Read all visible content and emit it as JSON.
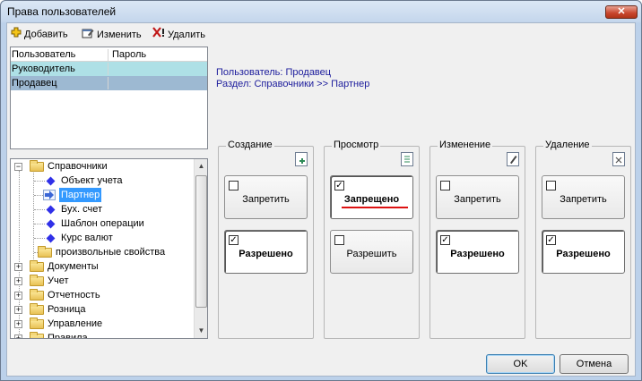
{
  "window": {
    "title": "Права пользователей",
    "close_label": "✕"
  },
  "toolbar": {
    "add_label": "Добавить",
    "edit_label": "Изменить",
    "delete_label": "Удалить"
  },
  "users_table": {
    "columns": [
      "Пользователь",
      "Пароль"
    ],
    "rows": [
      {
        "user": "Руководитель",
        "password": ""
      },
      {
        "user": "Продавец",
        "password": ""
      }
    ]
  },
  "info": {
    "user_line": "Пользователь:  Продавец",
    "section_line": "Раздел:  Справочники >> Партнер"
  },
  "tree": {
    "items": [
      {
        "label": "Справочники",
        "icon": "folder-icon",
        "expander": "−"
      },
      {
        "label": "Объект учета",
        "icon": "diamond-icon"
      },
      {
        "label": "Партнер",
        "icon": "arrow-icon",
        "selected": true
      },
      {
        "label": "Бух. счет",
        "icon": "diamond-icon"
      },
      {
        "label": "Шаблон операции",
        "icon": "diamond-icon"
      },
      {
        "label": "Курс валют",
        "icon": "diamond-icon"
      },
      {
        "label": "произвольные свойства",
        "icon": "folder-icon"
      },
      {
        "label": "Документы",
        "icon": "folder-icon",
        "expander": "+"
      },
      {
        "label": "Учет",
        "icon": "folder-icon",
        "expander": "+"
      },
      {
        "label": "Отчетность",
        "icon": "folder-icon",
        "expander": "+"
      },
      {
        "label": "Розница",
        "icon": "folder-icon",
        "expander": "+"
      },
      {
        "label": "Управление",
        "icon": "gear-folder-icon",
        "expander": "+"
      },
      {
        "label": "Правила",
        "icon": "gear-folder-icon",
        "expander": "+"
      }
    ]
  },
  "permissions": [
    {
      "title": "Создание",
      "icon": "create-doc-icon",
      "top": {
        "label": "Запретить",
        "checked": false,
        "active": false
      },
      "bottom": {
        "label": "Разрешено",
        "checked": true,
        "active": true
      }
    },
    {
      "title": "Просмотр",
      "icon": "view-doc-icon",
      "top": {
        "label": "Запрещено",
        "checked": true,
        "active": true
      },
      "bottom": {
        "label": "Разрешить",
        "checked": false,
        "active": false
      }
    },
    {
      "title": "Изменение",
      "icon": "edit-doc-icon",
      "top": {
        "label": "Запретить",
        "checked": false,
        "active": false
      },
      "bottom": {
        "label": "Разрешено",
        "checked": true,
        "active": true
      }
    },
    {
      "title": "Удаление",
      "icon": "delete-doc-icon",
      "top": {
        "label": "Запретить",
        "checked": false,
        "active": false
      },
      "bottom": {
        "label": "Разрешено",
        "checked": true,
        "active": true
      }
    }
  ],
  "buttons": {
    "ok_label": "OK",
    "cancel_label": "Отмена"
  },
  "colors": {
    "selection": "#3399ff",
    "row_highlight": "#aee0e6",
    "row_selected": "#9db9d2",
    "info_text": "#1c1c9c",
    "marker": "#dd1111"
  }
}
